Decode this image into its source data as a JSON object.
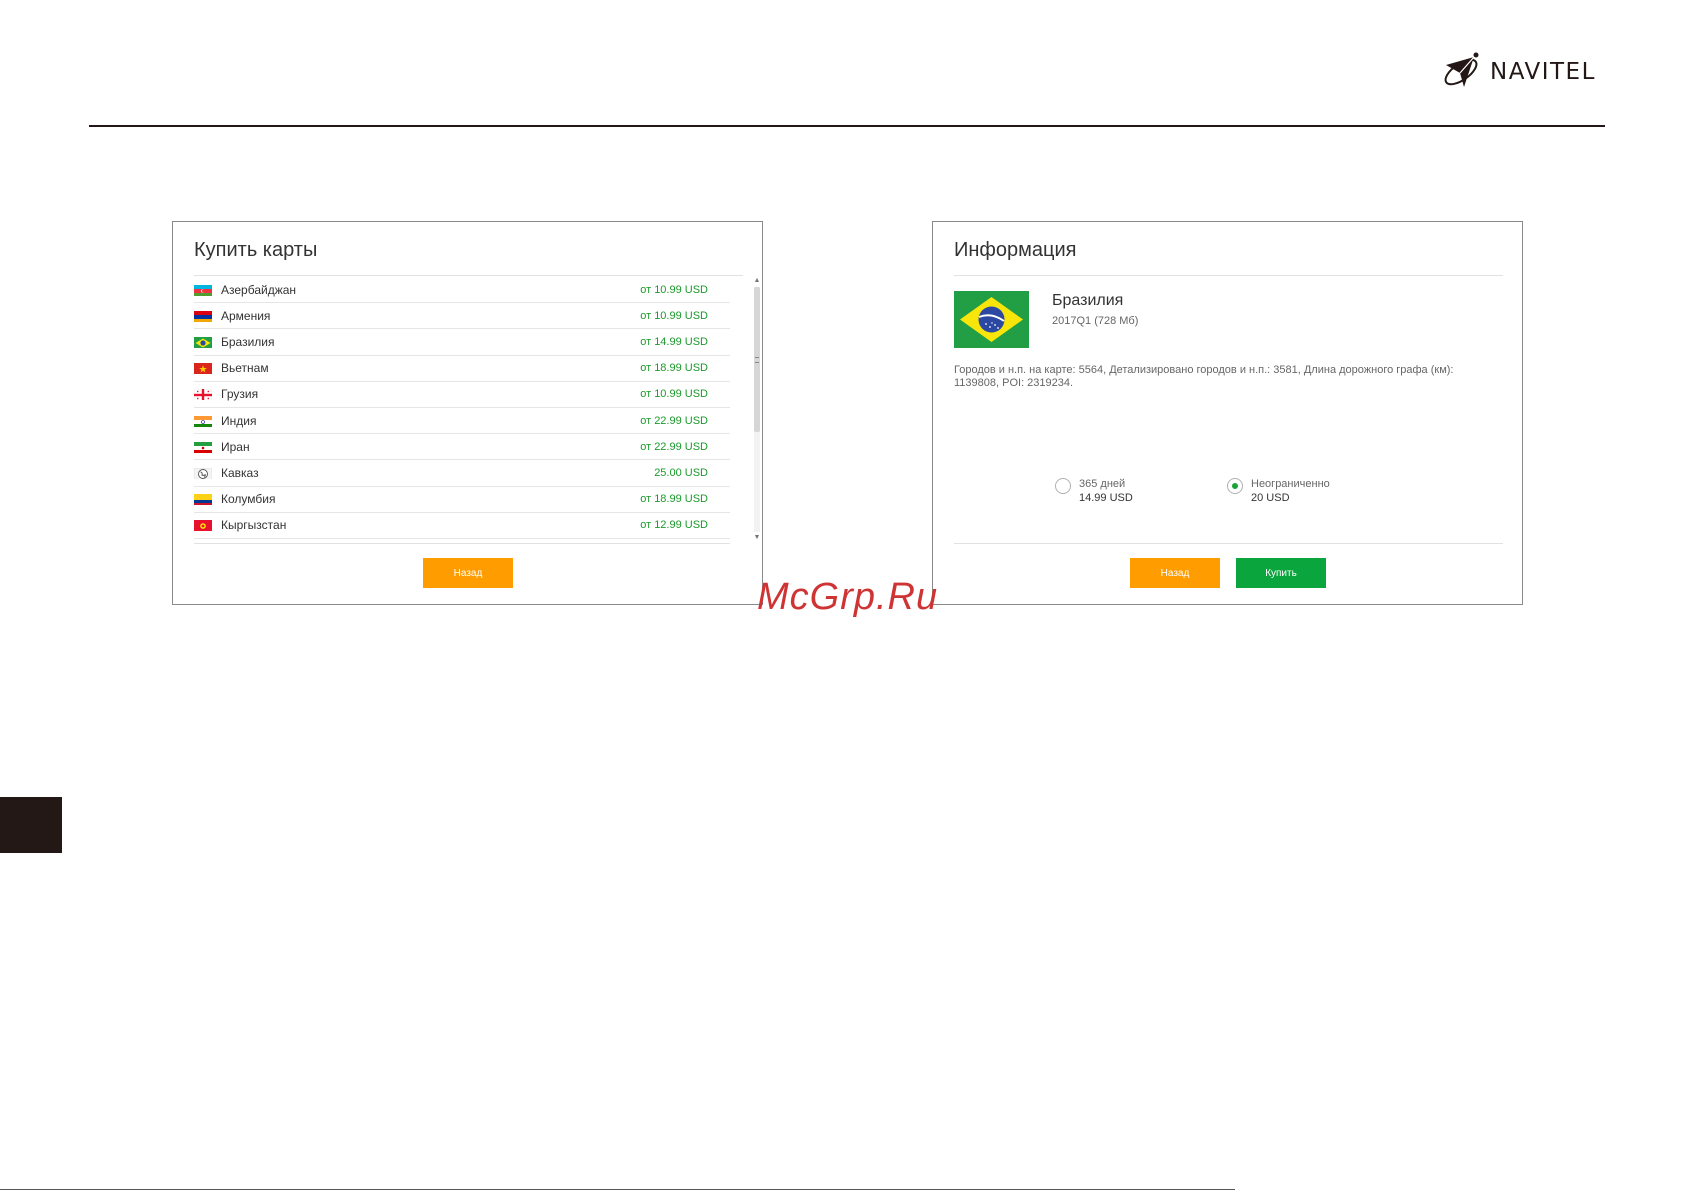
{
  "brand": {
    "name": "NAVITEL"
  },
  "buy_maps": {
    "title": "Купить карты",
    "back_label": "Назад",
    "maps": [
      {
        "name": "Азербайджан",
        "price": "от 10.99 USD",
        "flag": "azerbaijan-flag-icon"
      },
      {
        "name": "Армения",
        "price": "от 10.99 USD",
        "flag": "armenia-flag-icon"
      },
      {
        "name": "Бразилия",
        "price": "от 14.99 USD",
        "flag": "brazil-flag-icon"
      },
      {
        "name": "Вьетнам",
        "price": "от 18.99 USD",
        "flag": "vietnam-flag-icon"
      },
      {
        "name": "Грузия",
        "price": "от 10.99 USD",
        "flag": "georgia-flag-icon"
      },
      {
        "name": "Индия",
        "price": "от 22.99 USD",
        "flag": "india-flag-icon"
      },
      {
        "name": "Иран",
        "price": "от 22.99 USD",
        "flag": "iran-flag-icon"
      },
      {
        "name": "Кавказ",
        "price": "25.00 USD",
        "flag": "globe-icon"
      },
      {
        "name": "Колумбия",
        "price": "от 18.99 USD",
        "flag": "colombia-flag-icon"
      },
      {
        "name": "Кыргызстан",
        "price": "от 12.99 USD",
        "flag": "kyrgyzstan-flag-icon"
      }
    ]
  },
  "info": {
    "title": "Информация",
    "country": "Бразилия",
    "version": "2017Q1 (728 Мб)",
    "description": "Городов и н.п. на карте: 5564, Детализировано городов и н.п.: 3581, Длина дорожного графа (км): 1139808, POI: 2319234.",
    "options": [
      {
        "label": "365 дней",
        "price": "14.99 USD",
        "selected": false
      },
      {
        "label": "Неограниченно",
        "price": "20 USD",
        "selected": true
      }
    ],
    "back_label": "Назад",
    "buy_label": "Купить"
  },
  "watermark": "McGrp.Ru",
  "colors": {
    "price_green": "#1a9a2a",
    "back_orange": "#ff9c00",
    "buy_green": "#0ba53d",
    "dark": "#231816",
    "watermark_red": "#cf3435"
  }
}
